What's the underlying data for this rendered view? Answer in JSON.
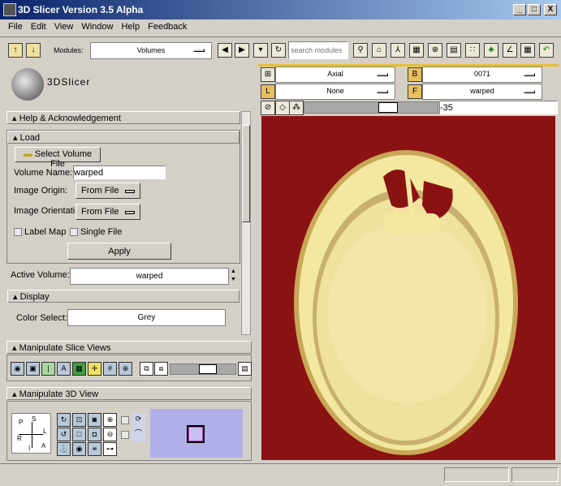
{
  "window": {
    "title": "3D Slicer Version 3.5 Alpha",
    "minimize": "_",
    "maximize": "□",
    "close": "X"
  },
  "menu": [
    "File",
    "Edit",
    "View",
    "Window",
    "Help",
    "Feedback"
  ],
  "toolbar": {
    "modules_label": "Modules:",
    "module_value": "Volumes",
    "search_placeholder": "search modules"
  },
  "logo": {
    "text": "3DSlicer"
  },
  "slice_controls": {
    "orientation": "Axial",
    "background": "0071",
    "label": "None",
    "foreground": "warped",
    "offset_value": "-35",
    "offset_slider": 0.65
  },
  "panel": {
    "help_header": "Help & Acknowledgement",
    "load_header": "Load",
    "select_volume_button": "Select Volume File",
    "volume_name_label": "Volume Name:",
    "volume_name_value": "warped",
    "image_origin_label": "Image Origin:",
    "image_origin_value": "From File",
    "image_orientation_label": "Image Orientation:",
    "image_orientation_value": "From File",
    "label_map_label": "Label Map",
    "single_file_label": "Single File",
    "apply_button": "Apply",
    "active_volume_label": "Active Volume:",
    "active_volume_value": "warped",
    "display_header": "Display",
    "color_select_label": "Color Select:",
    "color_select_value": "Grey"
  },
  "slice_views": {
    "header": "Manipulate Slice Views",
    "slider": 0.6
  },
  "view3d": {
    "header": "Manipulate 3D View",
    "axes": {
      "p": "P",
      "s": "S",
      "l": "L",
      "r": "R",
      "i": "I",
      "a": "A"
    }
  },
  "colors": {
    "title": "#0a246a",
    "background": "#8b1212",
    "tissue": "#f0e49a"
  }
}
